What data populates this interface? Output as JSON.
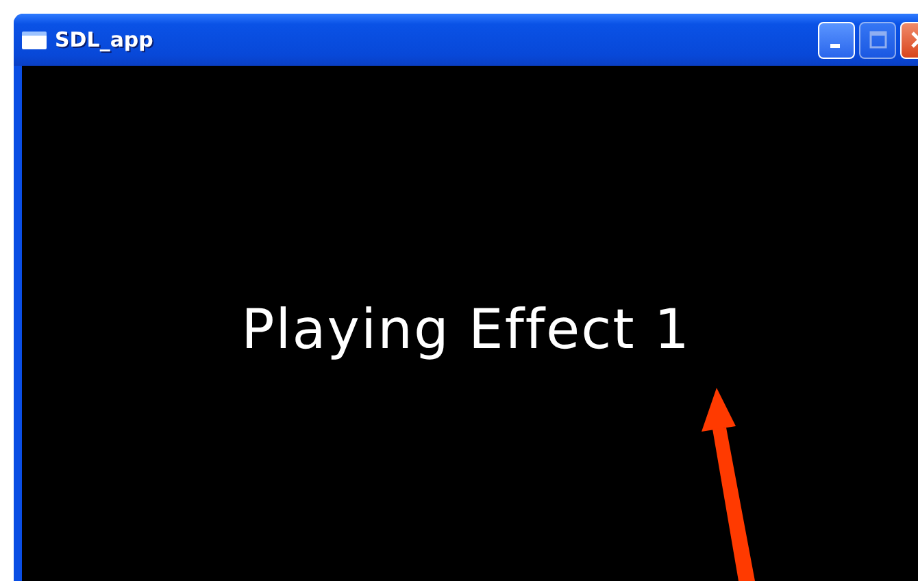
{
  "window": {
    "title": "SDL_app",
    "buttons": [
      {
        "kind": "minimize",
        "disabled": false
      },
      {
        "kind": "maximize",
        "disabled": true
      },
      {
        "kind": "close",
        "disabled": false
      }
    ]
  },
  "content": {
    "message": "Playing Effect 1"
  }
}
